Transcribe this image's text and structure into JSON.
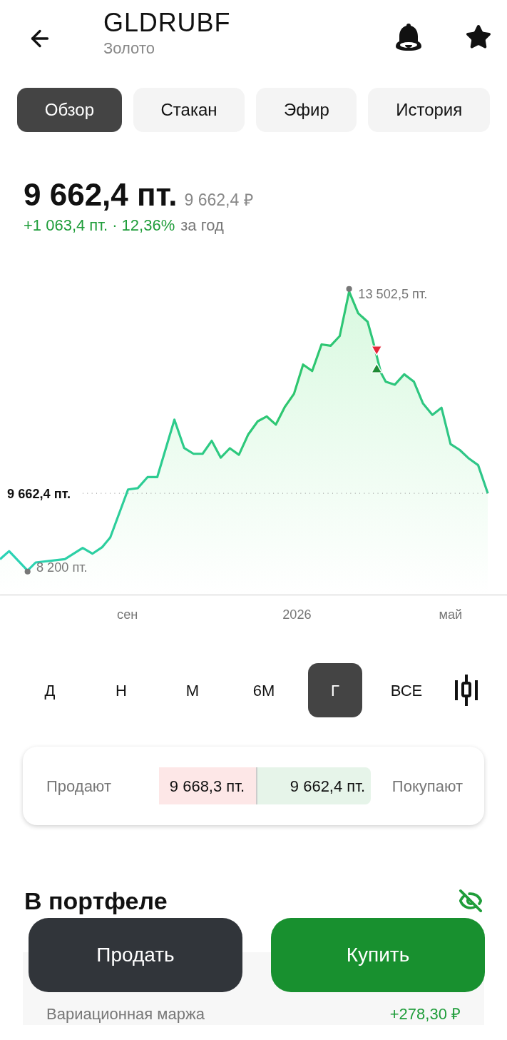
{
  "header": {
    "ticker": "GLDRUBF",
    "name": "Золото"
  },
  "tabs": [
    {
      "label": "Обзор",
      "selected": true
    },
    {
      "label": "Стакан",
      "selected": false
    },
    {
      "label": "Эфир",
      "selected": false
    },
    {
      "label": "История",
      "selected": false
    }
  ],
  "price": {
    "value": "9 662,4 пт.",
    "value_rub": "9 662,4 ₽",
    "change": "+1 063,4 пт. · 12,36%",
    "period": "за год"
  },
  "chart": {
    "max_label": "13 502,5 пт.",
    "min_label": "8 200 пт.",
    "current_label": "9 662,4 пт.",
    "x_labels": [
      "сен",
      "2026",
      "май"
    ]
  },
  "periods": [
    {
      "label": "Д",
      "selected": false
    },
    {
      "label": "Н",
      "selected": false
    },
    {
      "label": "М",
      "selected": false
    },
    {
      "label": "6М",
      "selected": false
    },
    {
      "label": "Г",
      "selected": true
    },
    {
      "label": "ВСЕ",
      "selected": false
    }
  ],
  "quotes": {
    "sell_label": "Продают",
    "sell_price": "9 668,3 пт.",
    "buy_price": "9 662,4 пт.",
    "buy_label": "Покупают"
  },
  "portfolio": {
    "title": "В портфеле",
    "margin_label": "Вариационная маржа",
    "margin_value": "+278,30 ₽"
  },
  "actions": [
    {
      "kind": "sell",
      "label": "Продать"
    },
    {
      "kind": "buy",
      "label": "Купить"
    }
  ]
}
